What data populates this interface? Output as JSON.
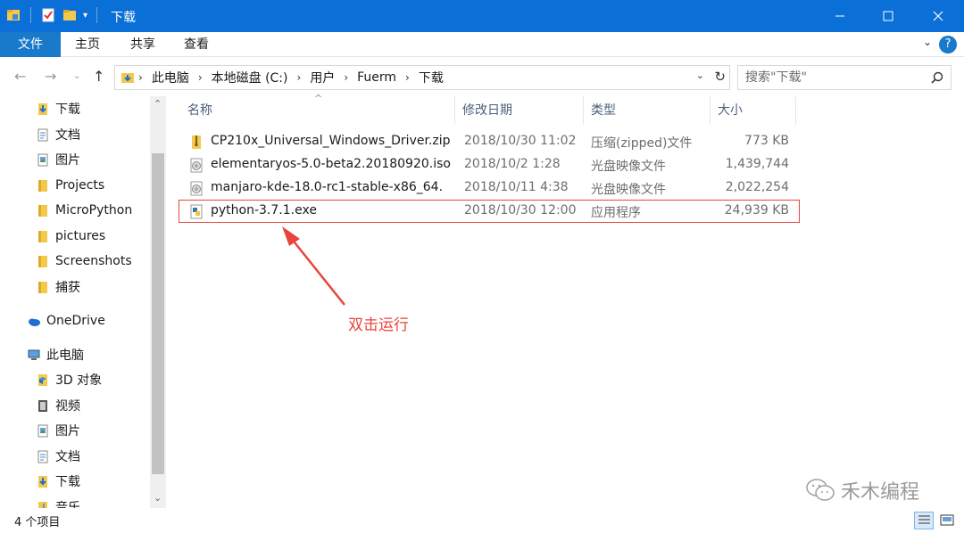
{
  "window": {
    "title": "下载",
    "controls": [
      "minimize-icon",
      "maximize-icon",
      "close-icon"
    ]
  },
  "ribbon": {
    "tabs": [
      "文件",
      "主页",
      "共享",
      "查看"
    ]
  },
  "address": {
    "crumbs": [
      "此电脑",
      "本地磁盘 (C:)",
      "用户",
      "Fuerm",
      "下载"
    ]
  },
  "search": {
    "placeholder": "搜索\"下载\""
  },
  "navpane": {
    "quick_access": [
      {
        "label": "下载",
        "icon": "download-folder-icon",
        "pinned": true
      },
      {
        "label": "文档",
        "icon": "documents-icon",
        "pinned": true
      },
      {
        "label": "图片",
        "icon": "pictures-icon",
        "pinned": true
      },
      {
        "label": "Projects",
        "icon": "folder-icon",
        "pinned": true
      },
      {
        "label": "MicroPython",
        "icon": "folder-icon",
        "pinned": false
      },
      {
        "label": "pictures",
        "icon": "folder-icon",
        "pinned": false
      },
      {
        "label": "Screenshots",
        "icon": "folder-icon",
        "pinned": false
      },
      {
        "label": "捕获",
        "icon": "folder-icon",
        "pinned": false
      }
    ],
    "onedrive": "OneDrive",
    "this_pc": "此电脑",
    "pc_items": [
      {
        "label": "3D 对象",
        "icon": "3d-objects-icon"
      },
      {
        "label": "视频",
        "icon": "videos-icon"
      },
      {
        "label": "图片",
        "icon": "pictures-icon"
      },
      {
        "label": "文档",
        "icon": "documents-icon"
      },
      {
        "label": "下载",
        "icon": "download-folder-icon"
      },
      {
        "label": "音乐",
        "icon": "music-icon"
      }
    ]
  },
  "files": {
    "columns": [
      "名称",
      "修改日期",
      "类型",
      "大小"
    ],
    "rows": [
      {
        "name": "CP210x_Universal_Windows_Driver.zip",
        "date": "2018/10/30 11:02",
        "type": "压缩(zipped)文件",
        "size": "773 KB",
        "icon": "zip-folder-icon"
      },
      {
        "name": "elementaryos-5.0-beta2.20180920.iso",
        "date": "2018/10/2 1:28",
        "type": "光盘映像文件",
        "size": "1,439,744",
        "icon": "disc-image-icon"
      },
      {
        "name": "manjaro-kde-18.0-rc1-stable-x86_64.",
        "date": "2018/10/11 4:38",
        "type": "光盘映像文件",
        "size": "2,022,254",
        "icon": "disc-image-icon"
      },
      {
        "name": "python-3.7.1.exe",
        "date": "2018/10/30 12:00",
        "type": "应用程序",
        "size": "24,939 KB",
        "icon": "python-installer-icon"
      }
    ]
  },
  "annotation": "双击运行",
  "watermark": "禾木编程",
  "status": {
    "count": "4 个项目"
  },
  "colors": {
    "titlebar": "#0a6fd6",
    "file_tab": "#1979ca",
    "annotation": "#e8453c",
    "folder": "#e8b83a"
  }
}
